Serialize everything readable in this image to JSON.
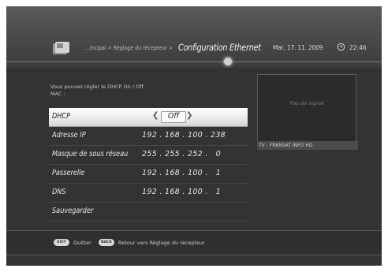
{
  "header": {
    "breadcrumb": "...incipal > Réglage du récepteur >",
    "title": "Configuration Ethernet",
    "date": "Mar, 17. 11. 2009",
    "time": "22:46",
    "clock_icon": "clock-icon",
    "logo_icon": "receiver-logo-icon"
  },
  "help_text": {
    "line1": "Vous pouvez régler le DHCP On / Off.",
    "line2": "MAC :"
  },
  "settings": [
    {
      "label": "DHCP",
      "value": "Off",
      "selected": true
    },
    {
      "label": "Adresse IP",
      "value": "192 . 168 . 100 . 238"
    },
    {
      "label": "Masque de sous réseau",
      "value": "255 . 255 . 252 .   0"
    },
    {
      "label": "Passerelle",
      "value": "192 . 168 . 100 .   1"
    },
    {
      "label": "DNS",
      "value": "192 . 168 . 100 .   1"
    },
    {
      "label": "Sauvegarder",
      "value": ""
    }
  ],
  "preview": {
    "status": "Pas de signal",
    "channel": "TV - FRANSAT INFO HD"
  },
  "footer": {
    "exit_key": "EXIT",
    "exit_label": "Quitter",
    "back_key": "BACK",
    "back_label": "Retour vers Réglage du récepteur"
  },
  "colors": {
    "background": "#333333",
    "highlight": "#f2f2f2",
    "text": "#e6e6e6"
  }
}
